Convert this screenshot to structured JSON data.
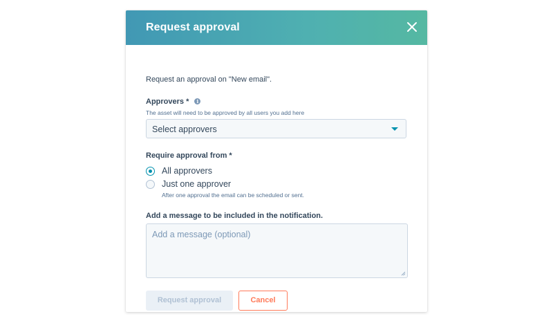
{
  "dialog": {
    "title": "Request approval",
    "close_icon": "close-icon",
    "intro_text": "Request an approval on \"New email\"."
  },
  "approvers": {
    "label": "Approvers *",
    "info_icon": "info-icon",
    "help_text": "The asset will need to be approved by all users you add here",
    "select_value": "Select approvers"
  },
  "require_from": {
    "label": "Require approval from *",
    "options": [
      {
        "label": "All approvers",
        "checked": true
      },
      {
        "label": "Just one approver",
        "checked": false
      }
    ],
    "one_approver_help": "After one approval the email can be scheduled or sent."
  },
  "message": {
    "label": "Add a message to be included in the notification.",
    "placeholder": "Add a message (optional)"
  },
  "buttons": {
    "request_label": "Request approval",
    "cancel_label": "Cancel"
  },
  "colors": {
    "header_gradient_start": "#4198b4",
    "header_gradient_end": "#55b8a2",
    "accent": "#0091ae",
    "cancel_orange": "#ff7a59"
  }
}
